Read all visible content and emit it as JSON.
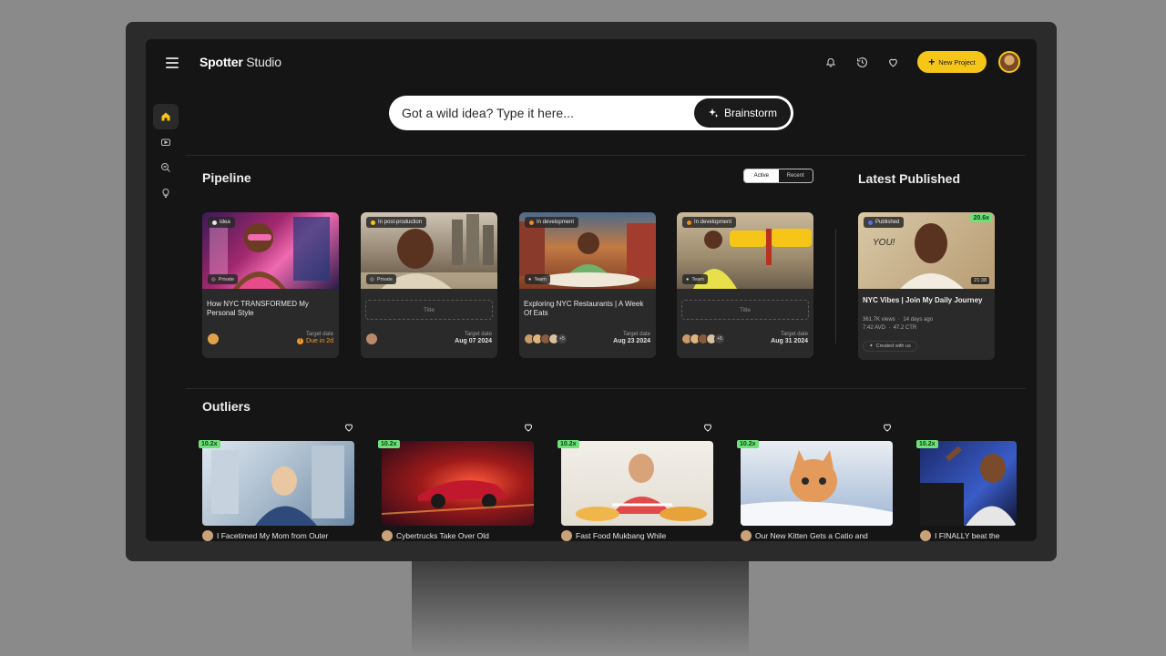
{
  "app": {
    "logo_bold": "Spotter",
    "logo_light": " Studio"
  },
  "header": {
    "new_project_label": "New Project"
  },
  "search": {
    "placeholder": "Got a wild idea? Type it here...",
    "button_label": "Brainstorm"
  },
  "pipeline": {
    "title": "Pipeline",
    "toggle": [
      "Active",
      "Recent"
    ],
    "cards": [
      {
        "status": "Idea",
        "status_color": "#e8e8e8",
        "visibility": "Private",
        "title": "How NYC TRANSFORMED My Personal Style",
        "target_label": "Target date",
        "target_value": "Due in 2d",
        "overdue": true
      },
      {
        "status": "In post-production",
        "status_color": "#f5c518",
        "visibility": "Private",
        "title_placeholder": "Title",
        "target_label": "Target date",
        "target_value": "Aug 07 2024"
      },
      {
        "status": "In development",
        "status_color": "#f08a24",
        "visibility": "Team",
        "title": "Exploring NYC Restaurants | A Week Of Eats",
        "target_label": "Target date",
        "target_value": "Aug 23 2024",
        "more_avatars": "+5"
      },
      {
        "status": "In development",
        "status_color": "#f08a24",
        "visibility": "Team",
        "title_placeholder": "Title",
        "target_label": "Target date",
        "target_value": "Aug 31 2024",
        "more_avatars": "+5"
      }
    ]
  },
  "latest_published": {
    "title": "Latest Published",
    "status": "Published",
    "multiplier": "20.6x",
    "duration": "21:38",
    "video_title": "NYC Vibes | Join My Daily Journey",
    "views": "361.7K views",
    "age": "14 days ago",
    "avd": "7:42 AVD",
    "ctr": "47.2 CTR",
    "created_with": "Created with us"
  },
  "outliers": {
    "title": "Outliers",
    "items": [
      {
        "multiplier": "10.2x",
        "title": "I Facetimed My Mom from Outer"
      },
      {
        "multiplier": "10.2x",
        "title": "Cybertrucks Take Over Old"
      },
      {
        "multiplier": "10.2x",
        "title": "Fast Food Mukbang While"
      },
      {
        "multiplier": "10.2x",
        "title": "Our New Kitten Gets a Catio and"
      },
      {
        "multiplier": "10.2x",
        "title": "I FINALLY beat the"
      }
    ]
  },
  "colors": {
    "accent": "#f5c518",
    "multiplier_bg": "#6ee07a",
    "background": "#151515",
    "card": "#2a2a2a"
  }
}
